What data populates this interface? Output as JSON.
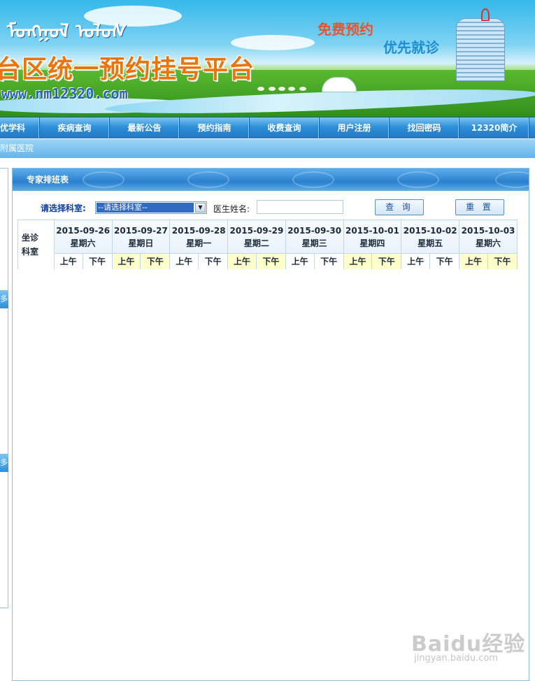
{
  "banner": {
    "mongol_script": "ᠮᠣᠩᠭᠣᠯ ᠤᠯᠤᠰ",
    "site_title": "台区统一预约挂号平台",
    "site_url": "www.nm12320.com",
    "slogan_primary": "免费预约",
    "slogan_secondary": "优先就诊"
  },
  "nav": {
    "items": [
      {
        "label": "优学科"
      },
      {
        "label": "疾病查询"
      },
      {
        "label": "最新公告"
      },
      {
        "label": "预约指南"
      },
      {
        "label": "收费查询"
      },
      {
        "label": "用户注册"
      },
      {
        "label": "找回密码"
      },
      {
        "label": "12320简介"
      }
    ]
  },
  "location": {
    "text": "附属医院"
  },
  "left_panel": {
    "box1_label": "多",
    "box2_label": "多"
  },
  "panel": {
    "title": "专家排班表",
    "filter": {
      "dept_label": "请选择科室:",
      "dept_selected": "--请选择科室--",
      "doctor_label": "医生姓名:",
      "doctor_value": "",
      "query_label": "查 询",
      "reset_label": "重 置"
    },
    "schedule": {
      "corner_label_1": "坐诊",
      "corner_label_2": "科室",
      "am_label": "上午",
      "pm_label": "下午",
      "days": [
        {
          "date": "2015-09-26",
          "weekday": "星期六",
          "highlight": false
        },
        {
          "date": "2015-09-27",
          "weekday": "星期日",
          "highlight": true
        },
        {
          "date": "2015-09-28",
          "weekday": "星期一",
          "highlight": false
        },
        {
          "date": "2015-09-29",
          "weekday": "星期二",
          "highlight": true
        },
        {
          "date": "2015-09-30",
          "weekday": "星期三",
          "highlight": false
        },
        {
          "date": "2015-10-01",
          "weekday": "星期四",
          "highlight": true
        },
        {
          "date": "2015-10-02",
          "weekday": "星期五",
          "highlight": false
        },
        {
          "date": "2015-10-03",
          "weekday": "星期六",
          "highlight": true
        }
      ]
    }
  },
  "watermark": {
    "logo": "Baidu经验",
    "url": "jingyan.baidu.com"
  }
}
